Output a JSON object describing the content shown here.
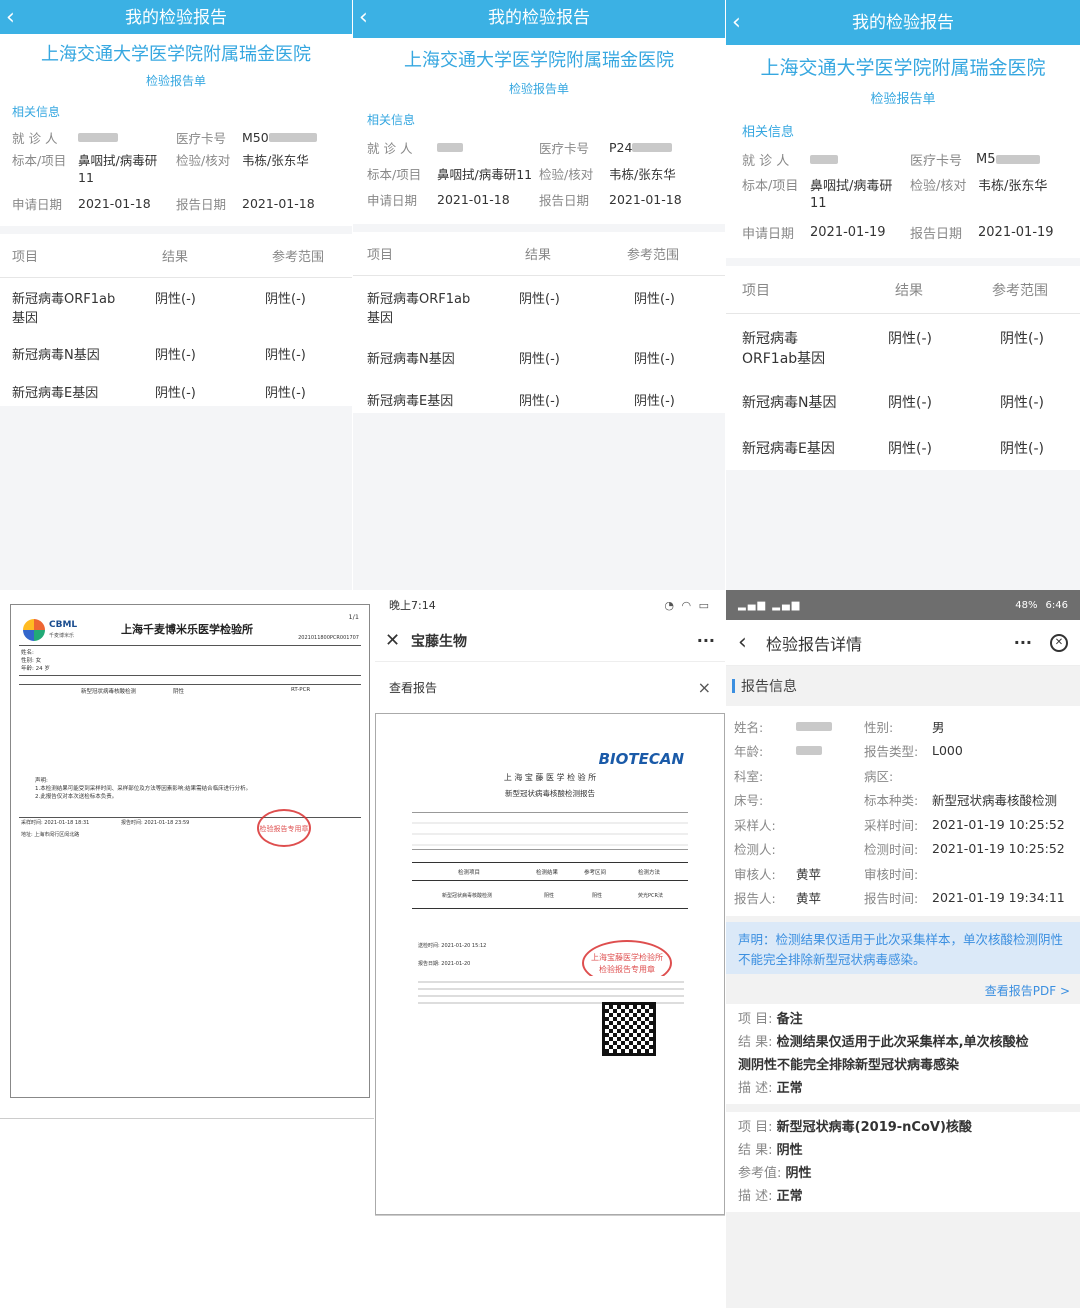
{
  "app": {
    "title": "我的检验报告",
    "hospital": "上海交通大学医学院附属瑞金医院",
    "doc_type": "检验报告单",
    "section": "相关信息",
    "back_icon": "chevron-left-icon"
  },
  "labels": {
    "patient": "就 诊 人",
    "card_no": "医疗卡号",
    "specimen": "标本/项目",
    "check": "检验/核对",
    "apply_date": "申请日期",
    "report_date": "报告日期",
    "col_item": "项目",
    "col_result": "结果",
    "col_ref": "参考范围"
  },
  "p1": {
    "card_no": "M50",
    "specimen": "鼻咽拭/病毒研",
    "specimen2": "11",
    "check": "韦栋/张东华",
    "apply_date": "2021-01-18",
    "report_date": "2021-01-18",
    "rows": [
      {
        "item": "新冠病毒ORF1ab",
        "item2": "基因",
        "result": "阴性(-)",
        "ref": "阴性(-)"
      },
      {
        "item": "新冠病毒N基因",
        "item2": "",
        "result": "阴性(-)",
        "ref": "阴性(-)"
      },
      {
        "item": "新冠病毒E基因",
        "item2": "",
        "result": "阴性(-)",
        "ref": "阴性(-)"
      }
    ]
  },
  "p2": {
    "card_no": "P24",
    "specimen": "鼻咽拭/病毒研11",
    "check": "韦栋/张东华",
    "apply_date": "2021-01-18",
    "report_date": "2021-01-18",
    "rows": [
      {
        "item": "新冠病毒ORF1ab",
        "item2": "基因",
        "result": "阴性(-)",
        "ref": "阴性(-)"
      },
      {
        "item": "新冠病毒N基因",
        "item2": "",
        "result": "阴性(-)",
        "ref": "阴性(-)"
      },
      {
        "item": "新冠病毒E基因",
        "item2": "",
        "result": "阴性(-)",
        "ref": "阴性(-)"
      }
    ]
  },
  "p3": {
    "card_no": "M5",
    "specimen": "鼻咽拭/病毒研",
    "specimen2": "11",
    "check": "韦栋/张东华",
    "apply_date": "2021-01-19",
    "report_date": "2021-01-19",
    "rows": [
      {
        "item": "新冠病毒",
        "item2": "ORF1ab基因",
        "result": "阴性(-)",
        "ref": "阴性(-)"
      },
      {
        "item": "新冠病毒N基因",
        "item2": "",
        "result": "阴性(-)",
        "ref": "阴性(-)"
      },
      {
        "item": "新冠病毒E基因",
        "item2": "",
        "result": "阴性(-)",
        "ref": "阴性(-)"
      }
    ]
  },
  "p4": {
    "logo": "CBML",
    "logo_sub": "千麦博米乐",
    "lab": "上海千麦博米乐医学检验所",
    "page": "1/1",
    "report_no": "2021011800PCR001707",
    "row1": "姓名:",
    "row2": "性别: 女",
    "row3": "年龄: 24 岁",
    "note_title": "声明:",
    "note1": "1.本检测结果可能受到采样时间、采样部位及方法等因素影响;结果需结合临床进行分析。",
    "note2": "2.此报告仅对本次送检标本负责。",
    "test": "新型冠状病毒核酸检测",
    "result": "阴性",
    "method": "RT-PCR",
    "sample_time": "采样时间: 2021-01-18 18:31",
    "report_time": "报告时间: 2021-01-18 23:59",
    "stamp": "检验报告专用章",
    "address": "地址: 上海市闵行区闵北路"
  },
  "p5": {
    "status_time": "晚上7:14",
    "close_icon": "close-icon",
    "title": "宝藤生物",
    "more": "···",
    "subtitle": "查看报告",
    "x": "×",
    "brand": "BIOTECAN",
    "lab": "上 海 宝 藤 医 学 检 验 所",
    "report_title": "新型冠状病毒核酸检测报告",
    "cols": [
      "检测项目",
      "检测结果",
      "参考区间",
      "检测方法"
    ],
    "row": [
      "新型冠状病毒核酸检测",
      "阴性",
      "阴性",
      "荧光PCR法"
    ],
    "stamp": "上海宝藤医学检验所",
    "stamp2": "检验报告专用章",
    "send_time": "送检时间: 2021-01-20 15:12",
    "report_time": "报告日期: 2021-01-20"
  },
  "p6": {
    "status": "48%",
    "status_time": "6:46",
    "title": "检验报告详情",
    "more": "···",
    "section": "报告信息",
    "fields_left": [
      {
        "k": "姓名:",
        "v": ""
      },
      {
        "k": "年龄:",
        "v": ""
      },
      {
        "k": "科室:",
        "v": ""
      },
      {
        "k": "床号:",
        "v": ""
      },
      {
        "k": "采样人:",
        "v": ""
      },
      {
        "k": "检测人:",
        "v": ""
      },
      {
        "k": "审核人:",
        "v": "黄苹"
      },
      {
        "k": "报告人:",
        "v": "黄苹"
      }
    ],
    "fields_right": [
      {
        "k": "性别:",
        "v": "男"
      },
      {
        "k": "报告类型:",
        "v": "L000"
      },
      {
        "k": "病区:",
        "v": ""
      },
      {
        "k": "标本种类:",
        "v": "新型冠状病毒核酸检测"
      },
      {
        "k": "采样时间:",
        "v": "2021-01-19 10:25:52"
      },
      {
        "k": "检测时间:",
        "v": "2021-01-19 10:25:52"
      },
      {
        "k": "审核时间:",
        "v": ""
      },
      {
        "k": "报告时间:",
        "v": "2021-01-19 19:34:11"
      }
    ],
    "notice": "声明：检测结果仅适用于此次采集样本，单次核酸检测阴性不能完全排除新型冠状病毒感染。",
    "pdf_link": "查看报告PDF >",
    "item1": {
      "k1": "项 目:",
      "v1": "备注",
      "k2": "结 果:",
      "v2": "检测结果仅适用于此次采集样本,单次核酸检",
      "v2b": "测阴性不能完全排除新型冠状病毒感染",
      "k3": "描 述:",
      "v3": "正常"
    },
    "item2": {
      "k1": "项 目:",
      "v1": "新型冠状病毒(2019-nCoV)核酸",
      "k2": "结 果:",
      "v2": "阴性",
      "k3": "参考值:",
      "v3": "阴性",
      "k4": "描 述:",
      "v4": "正常"
    }
  }
}
